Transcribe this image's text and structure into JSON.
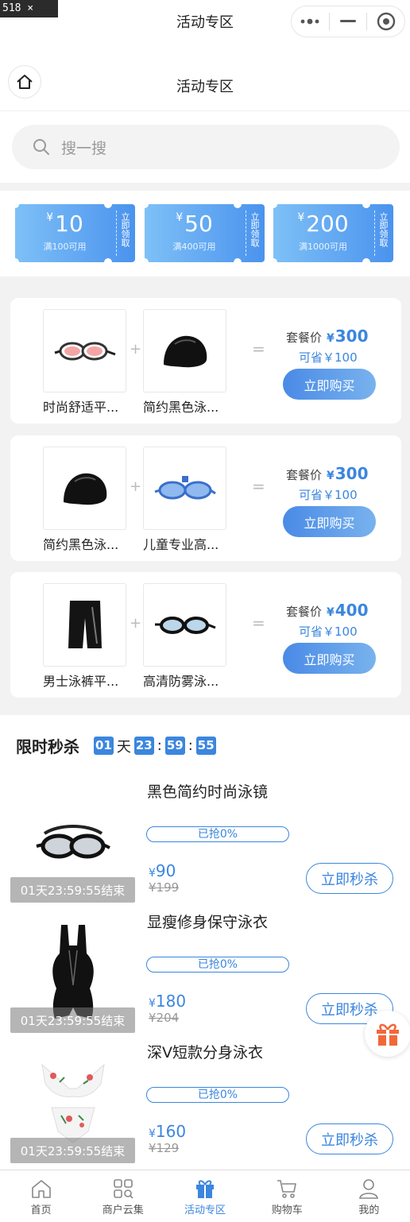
{
  "size_tag": "518 × 975",
  "window_title": "活动专区",
  "nav": {
    "title": "活动专区"
  },
  "search": {
    "placeholder": "搜一搜"
  },
  "coupons": [
    {
      "yen": "¥",
      "amount": "10",
      "condition": "满100可用",
      "claim": "立即领取"
    },
    {
      "yen": "¥",
      "amount": "50",
      "condition": "满400可用",
      "claim": "立即领取"
    },
    {
      "yen": "¥",
      "amount": "200",
      "condition": "满1000可用",
      "claim": "立即领取"
    }
  ],
  "combos": [
    {
      "items": [
        {
          "name": "时尚舒适平...",
          "icon": "goggles-pink-icon"
        },
        {
          "name": "简约黑色泳...",
          "icon": "swim-cap-icon"
        }
      ],
      "plus": "+",
      "equals": "=",
      "pkg_label": "套餐价",
      "yen": "¥",
      "price": "300",
      "save": "可省￥100",
      "buy": "立即购买"
    },
    {
      "items": [
        {
          "name": "简约黑色泳...",
          "icon": "swim-cap-icon"
        },
        {
          "name": "儿童专业高...",
          "icon": "goggles-blue-icon"
        }
      ],
      "plus": "+",
      "equals": "=",
      "pkg_label": "套餐价",
      "yen": "¥",
      "price": "300",
      "save": "可省￥100",
      "buy": "立即购买"
    },
    {
      "items": [
        {
          "name": "男士泳裤平...",
          "icon": "swim-trunks-icon"
        },
        {
          "name": "高清防雾泳...",
          "icon": "goggles-black-icon"
        }
      ],
      "plus": "+",
      "equals": "=",
      "pkg_label": "套餐价",
      "yen": "¥",
      "price": "400",
      "save": "可省￥100",
      "buy": "立即购买"
    }
  ],
  "flash": {
    "title": "限时秒杀",
    "countdown": {
      "days": "01",
      "day_unit": "天",
      "hours": "23",
      "minutes": "59",
      "seconds": "55",
      "sep": ":"
    },
    "items": [
      {
        "name": "黑色简约时尚泳镜",
        "progress": "已抢0%",
        "progress_fraction": 0,
        "yen": "¥",
        "price": "90",
        "orig": "¥199",
        "end": "01天23:59:55结束",
        "btn": "立即秒杀",
        "icon": "goggles-large-icon"
      },
      {
        "name": "显瘦修身保守泳衣",
        "progress": "已抢0%",
        "progress_fraction": 0,
        "yen": "¥",
        "price": "180",
        "orig": "¥204",
        "end": "01天23:59:55结束",
        "btn": "立即秒杀",
        "icon": "swimsuit-black-icon"
      },
      {
        "name": "深V短款分身泳衣",
        "progress": "已抢0%",
        "progress_fraction": 0,
        "yen": "¥",
        "price": "160",
        "orig": "¥129",
        "end": "01天23:59:55结束",
        "btn": "立即秒杀",
        "icon": "bikini-floral-icon"
      }
    ]
  },
  "tabs": [
    {
      "label": "首页",
      "icon": "home-icon",
      "active": false
    },
    {
      "label": "商户云集",
      "icon": "grid-icon",
      "active": false
    },
    {
      "label": "活动专区",
      "icon": "gift-icon",
      "active": true
    },
    {
      "label": "购物车",
      "icon": "cart-icon",
      "active": false
    },
    {
      "label": "我的",
      "icon": "user-icon",
      "active": false
    }
  ],
  "colors": {
    "accent": "#3b86de",
    "coupon_start": "#7ec0f7",
    "coupon_end": "#4a93ee",
    "gift": "#f2673a"
  }
}
